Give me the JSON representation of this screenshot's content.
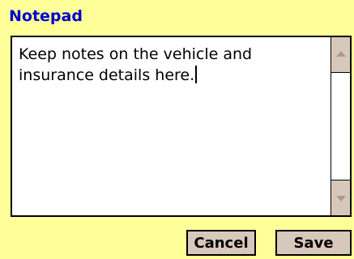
{
  "window": {
    "title": "Notepad"
  },
  "notes": {
    "text": "Keep notes on the vehicle and\ninsurance details here."
  },
  "scrollbar": {
    "up_icon": "scroll-up-arrow-icon",
    "down_icon": "scroll-down-arrow-icon"
  },
  "buttons": {
    "cancel_label": "Cancel",
    "save_label": "Save"
  },
  "colors": {
    "background": "#ffff99",
    "title": "#0000cc",
    "button_face": "#d8c8bb",
    "text_area": "#ffffff"
  }
}
